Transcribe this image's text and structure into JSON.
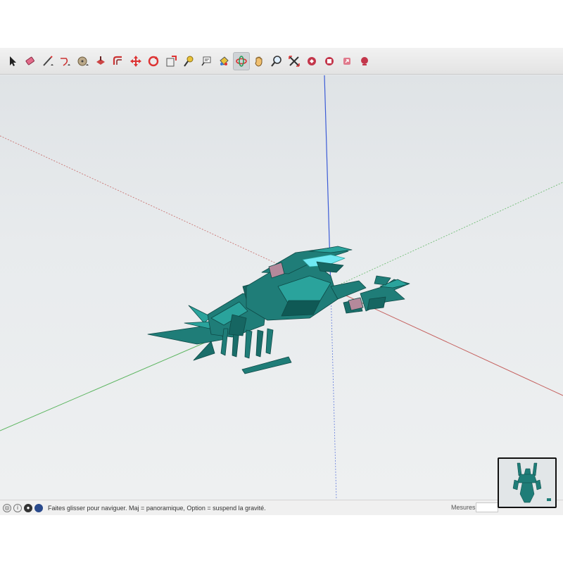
{
  "toolbar": {
    "tools": [
      {
        "icon": "select-arrow-icon"
      },
      {
        "icon": "eraser-icon"
      },
      {
        "icon": "line-pencil-icon"
      },
      {
        "icon": "arc-icon"
      },
      {
        "icon": "circle-shape-icon"
      },
      {
        "icon": "push-pull-icon"
      },
      {
        "icon": "offset-icon"
      },
      {
        "icon": "move-icon"
      },
      {
        "icon": "rotate-icon"
      },
      {
        "icon": "scale-icon"
      },
      {
        "icon": "tape-measure-icon"
      },
      {
        "icon": "text-label-icon"
      },
      {
        "icon": "paint-bucket-icon"
      },
      {
        "icon": "orbit-icon",
        "active": true
      },
      {
        "icon": "pan-hand-icon"
      },
      {
        "icon": "zoom-icon"
      },
      {
        "icon": "zoom-extents-icon"
      },
      {
        "icon": "warehouse-icon"
      },
      {
        "icon": "extension-warehouse-icon"
      },
      {
        "icon": "share-model-icon"
      },
      {
        "icon": "layout-icon"
      }
    ]
  },
  "colors": {
    "model": "#1f7d78",
    "model_dark": "#0e4a47",
    "model_light": "#2aa39c",
    "highlight": "#6fe8f2",
    "axis_red": "#c0504d",
    "axis_green": "#4caf50",
    "axis_blue": "#3b5bd6",
    "band": "#b4899b"
  },
  "status": {
    "hint": "Faites glisser pour naviguer. Maj = panoramique, Option = suspend la gravité.",
    "measures_label": "Mesures",
    "measures_value": ""
  }
}
